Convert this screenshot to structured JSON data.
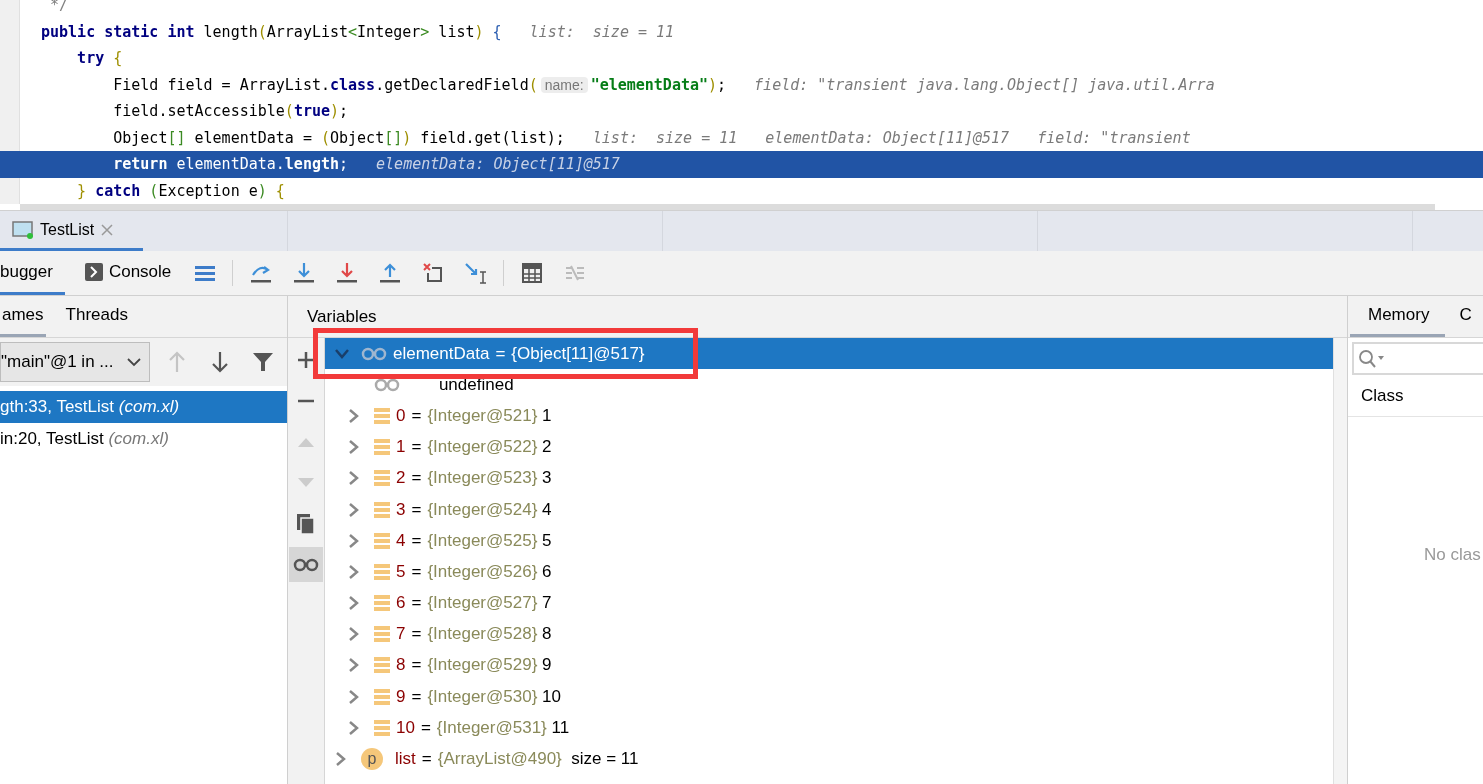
{
  "editor": {
    "lines": [
      {
        "selected": false,
        "tokens": [
          {
            "kind": "comment",
            "text": " */"
          }
        ]
      },
      {
        "selected": false,
        "tokens": [
          {
            "kind": "kw",
            "text": "public static int"
          },
          {
            "kind": "plain",
            "text": " length"
          },
          {
            "kind": "paren1",
            "text": "("
          },
          {
            "kind": "plain",
            "text": "ArrayList"
          },
          {
            "kind": "paren2",
            "text": "<"
          },
          {
            "kind": "plain",
            "text": "Integer"
          },
          {
            "kind": "paren2",
            "text": ">"
          },
          {
            "kind": "plain",
            "text": " list"
          },
          {
            "kind": "paren1",
            "text": ")"
          },
          {
            "kind": "paren3",
            "text": " {"
          },
          {
            "kind": "hint",
            "text": "list:  size = 11"
          }
        ]
      },
      {
        "selected": false,
        "tokens": [
          {
            "kind": "kw",
            "text": "    try"
          },
          {
            "kind": "paren1",
            "text": " {"
          }
        ]
      },
      {
        "selected": false,
        "tokens": [
          {
            "kind": "plain",
            "text": "        Field field = ArrayList."
          },
          {
            "kind": "kw",
            "text": "class"
          },
          {
            "kind": "plain",
            "text": ".getDeclaredField"
          },
          {
            "kind": "paren1",
            "text": "("
          },
          {
            "kind": "param",
            "text": "name:"
          },
          {
            "kind": "str",
            "text": "\"elementData\""
          },
          {
            "kind": "paren1",
            "text": ")"
          },
          {
            "kind": "plain",
            "text": ";"
          },
          {
            "kind": "hint",
            "text": "field: \"transient java.lang.Object[] java.util.Arra"
          }
        ]
      },
      {
        "selected": false,
        "tokens": [
          {
            "kind": "plain",
            "text": "        field.setAccessible"
          },
          {
            "kind": "paren1",
            "text": "("
          },
          {
            "kind": "kw",
            "text": "true"
          },
          {
            "kind": "paren1",
            "text": ")"
          },
          {
            "kind": "plain",
            "text": ";"
          }
        ]
      },
      {
        "selected": false,
        "tokens": [
          {
            "kind": "plain",
            "text": "        Object"
          },
          {
            "kind": "paren2",
            "text": "[]"
          },
          {
            "kind": "plain",
            "text": " elementData = "
          },
          {
            "kind": "paren1",
            "text": "("
          },
          {
            "kind": "plain",
            "text": "Object"
          },
          {
            "kind": "paren2",
            "text": "[]"
          },
          {
            "kind": "paren1",
            "text": ")"
          },
          {
            "kind": "plain",
            "text": " field.get(list);"
          },
          {
            "kind": "hint",
            "text": "list:  size = 11"
          },
          {
            "kind": "hint",
            "text": "elementData: Object[11]@517"
          },
          {
            "kind": "hint",
            "text": "field: \"transient"
          }
        ]
      },
      {
        "selected": true,
        "tokens": [
          {
            "kind": "kw",
            "text": "        return"
          },
          {
            "kind": "plain",
            "text": " elementData."
          },
          {
            "kind": "kw",
            "text": "length"
          },
          {
            "kind": "plain",
            "text": ";"
          },
          {
            "kind": "hint",
            "text": "elementData: Object[11]@517"
          }
        ]
      },
      {
        "selected": false,
        "tokens": [
          {
            "kind": "paren1",
            "text": "    }"
          },
          {
            "kind": "kw",
            "text": " catch"
          },
          {
            "kind": "paren2",
            "text": " ("
          },
          {
            "kind": "plain",
            "text": "Exception e"
          },
          {
            "kind": "paren2",
            "text": ")"
          },
          {
            "kind": "paren1",
            "text": " {"
          }
        ]
      }
    ]
  },
  "run_tab": {
    "label": "TestList"
  },
  "debug_tabs": [
    {
      "label": "bugger",
      "selected": true
    },
    {
      "label": "Console",
      "selected": false
    }
  ],
  "frames_panel": {
    "tabs": [
      {
        "label": "ames",
        "selected": true
      },
      {
        "label": "Threads",
        "selected": false
      }
    ],
    "thread": "\"main\"@1 in ...",
    "frames": [
      {
        "text": "gth:33, TestList",
        "package": "(com.xl)",
        "selected": true
      },
      {
        "text": "in:20, TestList",
        "package": "(com.xl)",
        "selected": false
      }
    ]
  },
  "variables": {
    "title": "Variables",
    "items": [
      {
        "kind": "watch",
        "name": "elementData",
        "operator": "=",
        "value": "{Object[11]@517}",
        "selected": true,
        "expanded": true,
        "children": [
          {
            "kind": "watch",
            "name": "undefined",
            "selected": false
          },
          {
            "kind": "entry",
            "name": "0",
            "operator": "=",
            "type": "{Integer@521}",
            "value": "1",
            "selected": false,
            "expanded": false
          },
          {
            "kind": "entry",
            "name": "1",
            "operator": "=",
            "type": "{Integer@522}",
            "value": "2",
            "selected": false,
            "expanded": false
          },
          {
            "kind": "entry",
            "name": "2",
            "operator": "=",
            "type": "{Integer@523}",
            "value": "3",
            "selected": false,
            "expanded": false
          },
          {
            "kind": "entry",
            "name": "3",
            "operator": "=",
            "type": "{Integer@524}",
            "value": "4",
            "selected": false,
            "expanded": false
          },
          {
            "kind": "entry",
            "name": "4",
            "operator": "=",
            "type": "{Integer@525}",
            "value": "5",
            "selected": false,
            "expanded": false
          },
          {
            "kind": "entry",
            "name": "5",
            "operator": "=",
            "type": "{Integer@526}",
            "value": "6",
            "selected": false,
            "expanded": false
          },
          {
            "kind": "entry",
            "name": "6",
            "operator": "=",
            "type": "{Integer@527}",
            "value": "7",
            "selected": false,
            "expanded": false
          },
          {
            "kind": "entry",
            "name": "7",
            "operator": "=",
            "type": "{Integer@528}",
            "value": "8",
            "selected": false,
            "expanded": false
          },
          {
            "kind": "entry",
            "name": "8",
            "operator": "=",
            "type": "{Integer@529}",
            "value": "9",
            "selected": false,
            "expanded": false
          },
          {
            "kind": "entry",
            "name": "9",
            "operator": "=",
            "type": "{Integer@530}",
            "value": "10",
            "selected": false,
            "expanded": false
          },
          {
            "kind": "entry",
            "name": "10",
            "operator": "=",
            "type": "{Integer@531}",
            "value": "11",
            "selected": false,
            "expanded": false
          }
        ]
      },
      {
        "kind": "param",
        "badge": "p",
        "name": "list",
        "operator": "=",
        "type": "{ArrayList@490}",
        "value": "size = 11",
        "selected": false,
        "expanded": false
      }
    ]
  },
  "memory_panel": {
    "tabs": [
      {
        "label": "Memory",
        "selected": true
      },
      {
        "label": "C",
        "selected": false
      }
    ],
    "column": "Class",
    "empty_text": "No clas"
  }
}
